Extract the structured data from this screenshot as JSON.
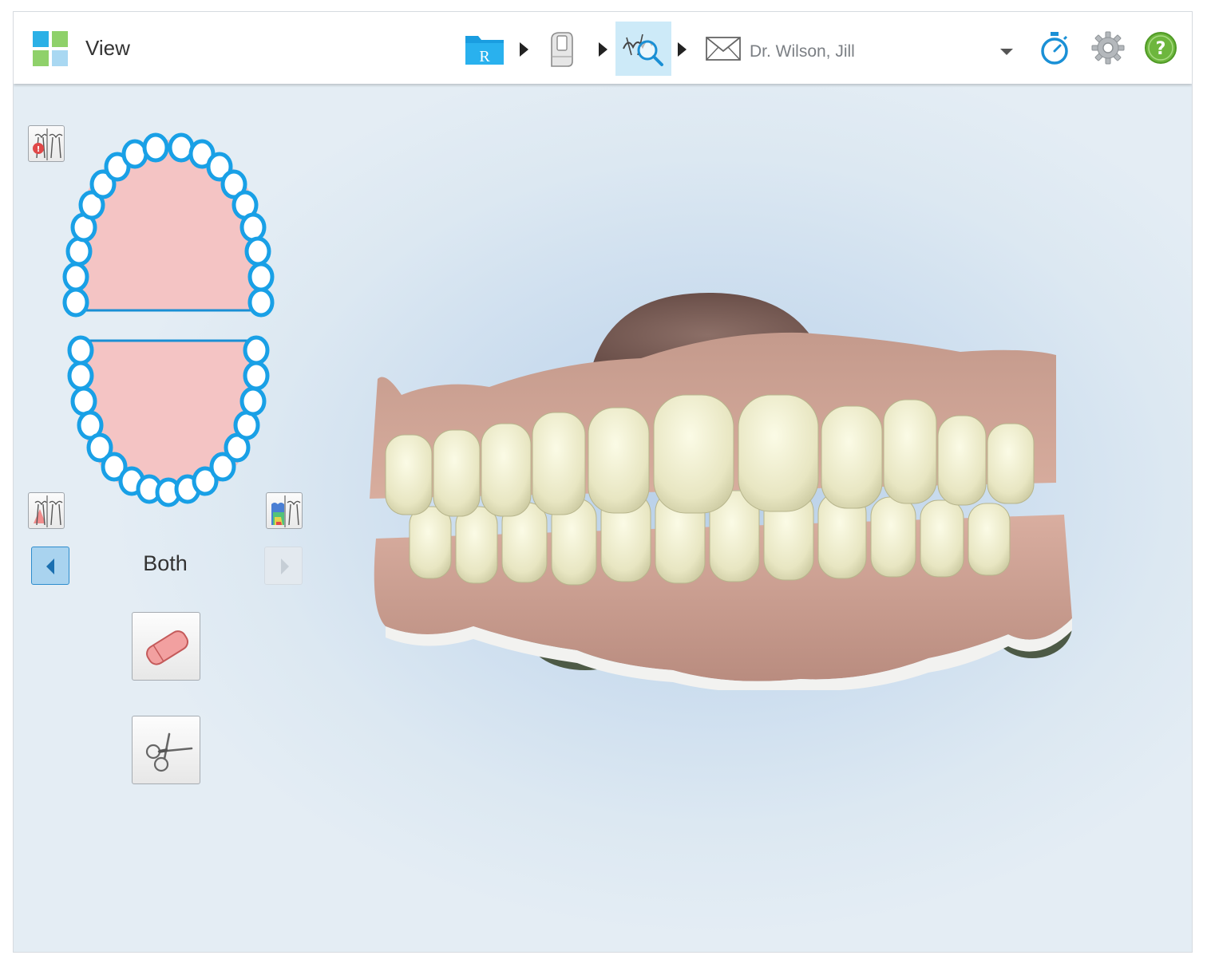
{
  "header": {
    "title": "View",
    "doctor_name": "Dr. Wilson, Jill",
    "rx_letter": "R"
  },
  "workflow_steps": [
    {
      "name": "rx",
      "icon": "rx-folder-icon"
    },
    {
      "name": "scan",
      "icon": "scanner-wand-icon"
    },
    {
      "name": "view",
      "icon": "view-magnify-icon",
      "active": true
    },
    {
      "name": "send",
      "icon": "send-envelope-icon"
    }
  ],
  "jaw_nav": {
    "label": "Both"
  },
  "colors": {
    "accent_blue": "#1aa3e6",
    "active_step_bg": "#cdeaf8",
    "gum_pink": "#f4c4c4",
    "help_green": "#69b53a"
  }
}
